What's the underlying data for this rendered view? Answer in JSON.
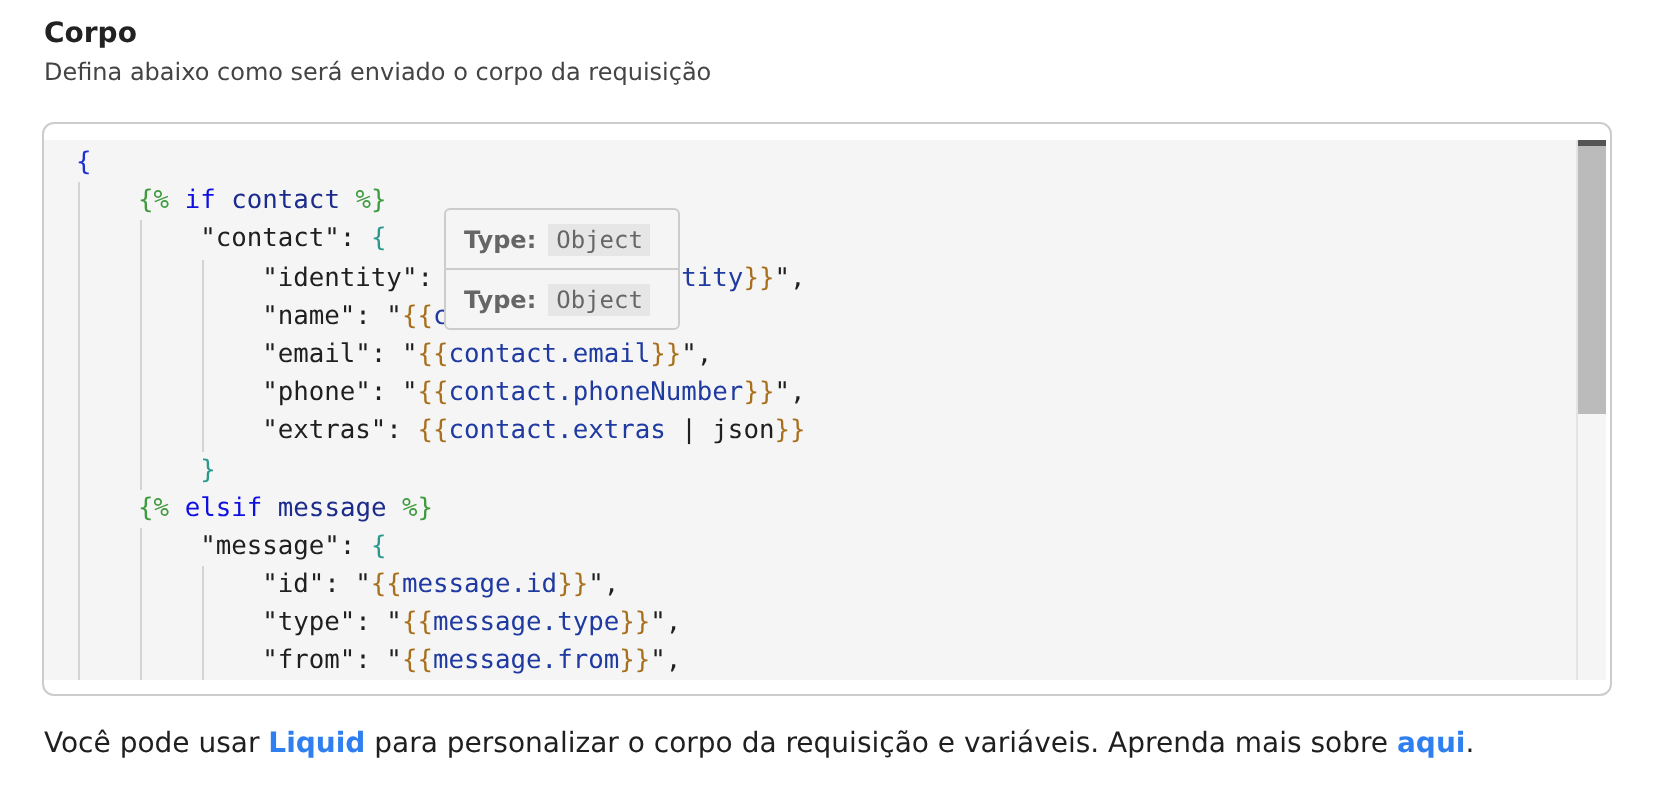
{
  "section": {
    "title": "Corpo",
    "subtitle": "Defina abaixo como será enviado o corpo da requisição"
  },
  "editor": {
    "lines": [
      {
        "tokens": [
          {
            "kind": "root",
            "text": "{"
          }
        ],
        "children": [
          {
            "tokens": [
              {
                "kind": "tagmark",
                "text": "{% "
              },
              {
                "kind": "keyword",
                "text": "if "
              },
              {
                "kind": "ident",
                "text": "contact "
              },
              {
                "kind": "tagmark",
                "text": "%}"
              }
            ],
            "children": [
              {
                "tokens": [
                  {
                    "kind": "text",
                    "text": "\"contact\": "
                  },
                  {
                    "kind": "jbrace",
                    "text": "{"
                  }
                ],
                "children": [
                  {
                    "tokens": [
                      {
                        "kind": "text",
                        "text": "\"identity\": "
                      },
                      {
                        "kind": "var_after_tooltip",
                        "text": "tity"
                      },
                      {
                        "kind": "lbrace",
                        "text": "}}"
                      },
                      {
                        "kind": "text",
                        "text": "\","
                      }
                    ]
                  },
                  {
                    "tokens": [
                      {
                        "kind": "text",
                        "text": "\"name\": \""
                      },
                      {
                        "kind": "lbrace",
                        "text": "{{"
                      },
                      {
                        "kind": "var",
                        "text": "c"
                      }
                    ]
                  },
                  {
                    "tokens": [
                      {
                        "kind": "text",
                        "text": "\"email\": \""
                      },
                      {
                        "kind": "lbrace",
                        "text": "{{"
                      },
                      {
                        "kind": "var",
                        "text": "contact.email"
                      },
                      {
                        "kind": "lbrace",
                        "text": "}}"
                      },
                      {
                        "kind": "text",
                        "text": "\","
                      }
                    ]
                  },
                  {
                    "tokens": [
                      {
                        "kind": "text",
                        "text": "\"phone\": \""
                      },
                      {
                        "kind": "lbrace",
                        "text": "{{"
                      },
                      {
                        "kind": "var",
                        "text": "contact.phoneNumber"
                      },
                      {
                        "kind": "lbrace",
                        "text": "}}"
                      },
                      {
                        "kind": "text",
                        "text": "\","
                      }
                    ]
                  },
                  {
                    "tokens": [
                      {
                        "kind": "text",
                        "text": "\"extras\": "
                      },
                      {
                        "kind": "lbrace",
                        "text": "{{"
                      },
                      {
                        "kind": "var",
                        "text": "contact.extras"
                      },
                      {
                        "kind": "text",
                        "text": " | json"
                      },
                      {
                        "kind": "lbrace",
                        "text": "}}"
                      }
                    ]
                  }
                ]
              },
              {
                "tokens": [
                  {
                    "kind": "jbrace",
                    "text": "}"
                  }
                ]
              }
            ]
          },
          {
            "tokens": [
              {
                "kind": "tagmark",
                "text": "{% "
              },
              {
                "kind": "keyword",
                "text": "elsif "
              },
              {
                "kind": "ident",
                "text": "message "
              },
              {
                "kind": "tagmark",
                "text": "%}"
              }
            ],
            "children": [
              {
                "tokens": [
                  {
                    "kind": "text",
                    "text": "\"message\": "
                  },
                  {
                    "kind": "jbrace",
                    "text": "{"
                  }
                ],
                "children": [
                  {
                    "tokens": [
                      {
                        "kind": "text",
                        "text": "\"id\": \""
                      },
                      {
                        "kind": "lbrace",
                        "text": "{{"
                      },
                      {
                        "kind": "var",
                        "text": "message.id"
                      },
                      {
                        "kind": "lbrace",
                        "text": "}}"
                      },
                      {
                        "kind": "text",
                        "text": "\","
                      }
                    ]
                  },
                  {
                    "tokens": [
                      {
                        "kind": "text",
                        "text": "\"type\": \""
                      },
                      {
                        "kind": "lbrace",
                        "text": "{{"
                      },
                      {
                        "kind": "var",
                        "text": "message.type"
                      },
                      {
                        "kind": "lbrace",
                        "text": "}}"
                      },
                      {
                        "kind": "text",
                        "text": "\","
                      }
                    ]
                  },
                  {
                    "tokens": [
                      {
                        "kind": "text",
                        "text": "\"from\": \""
                      },
                      {
                        "kind": "lbrace",
                        "text": "{{"
                      },
                      {
                        "kind": "var",
                        "text": "message.from"
                      },
                      {
                        "kind": "lbrace",
                        "text": "}}"
                      },
                      {
                        "kind": "text",
                        "text": "\","
                      }
                    ]
                  }
                ]
              }
            ]
          }
        ]
      }
    ],
    "tooltip": {
      "rows": [
        {
          "label": "Type:",
          "value": "Object"
        },
        {
          "label": "Type:",
          "value": "Object"
        }
      ]
    }
  },
  "footer": [
    {
      "kind": "text",
      "text": "Você pode usar "
    },
    {
      "kind": "link",
      "text": "Liquid"
    },
    {
      "kind": "text",
      "text": " para personalizar o corpo da requisição e variáveis. Aprenda mais sobre "
    },
    {
      "kind": "link",
      "text": "aqui"
    },
    {
      "kind": "text",
      "text": "."
    }
  ]
}
